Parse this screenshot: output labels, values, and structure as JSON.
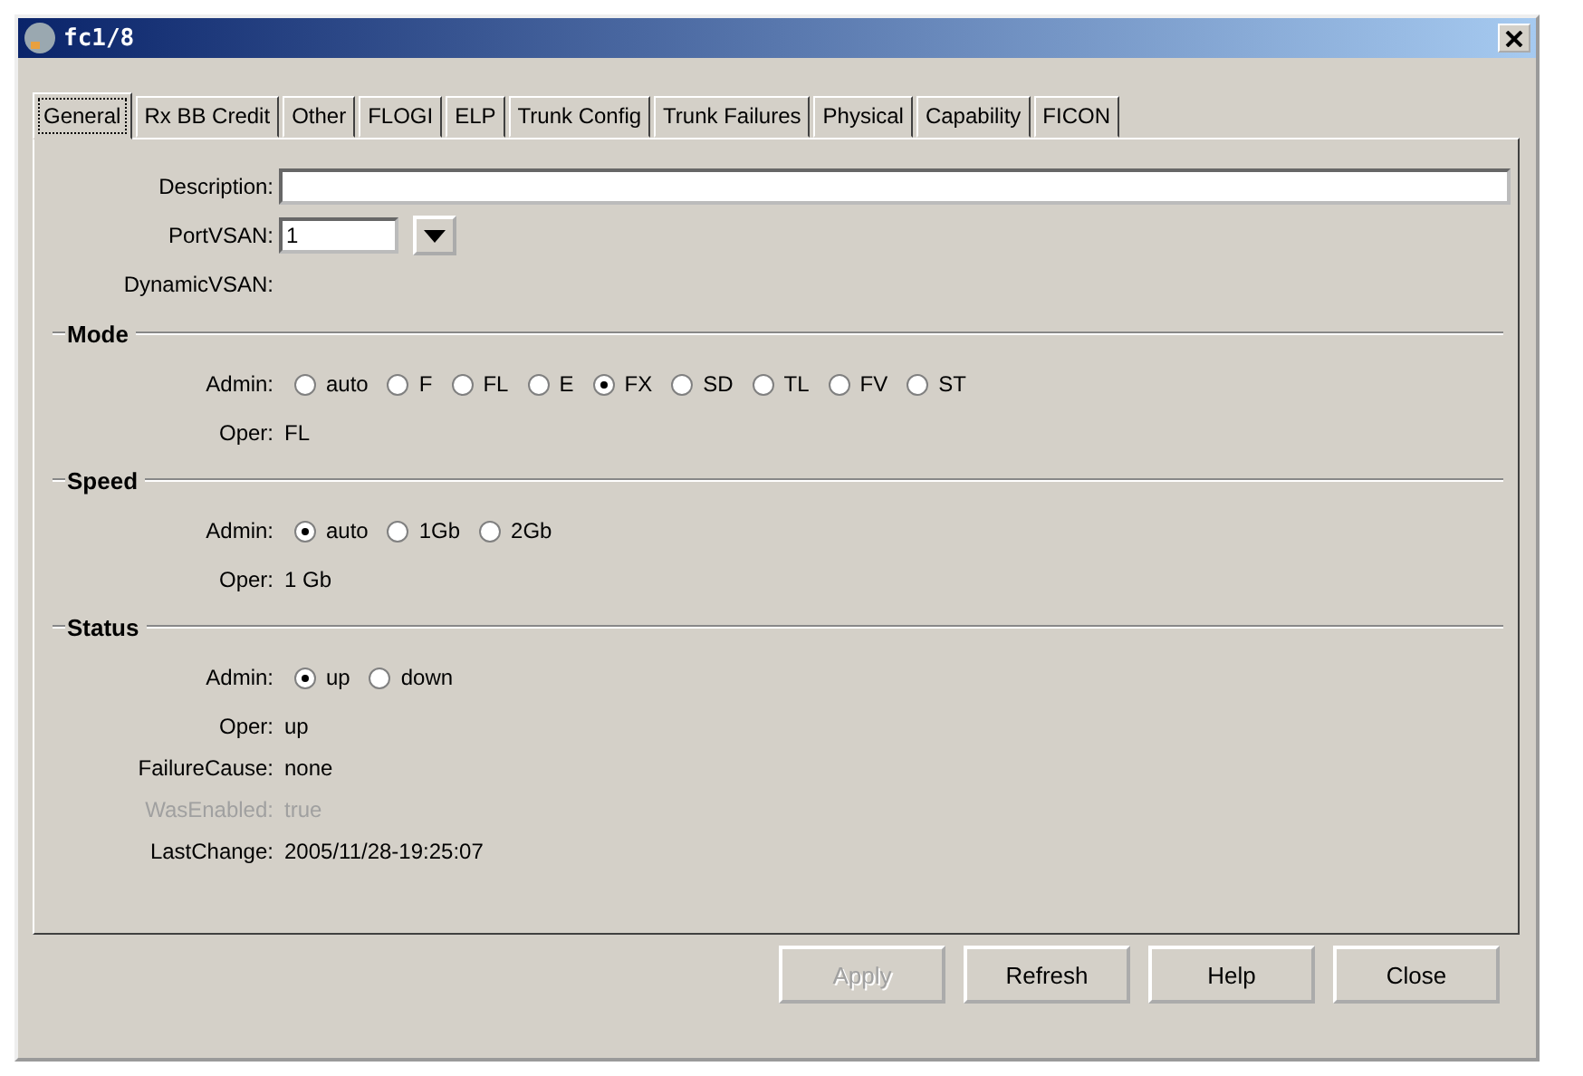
{
  "window": {
    "title": "fc1/8"
  },
  "tabs": [
    {
      "label": "General",
      "selected": true
    },
    {
      "label": "Rx BB Credit",
      "selected": false
    },
    {
      "label": "Other",
      "selected": false
    },
    {
      "label": "FLOGI",
      "selected": false
    },
    {
      "label": "ELP",
      "selected": false
    },
    {
      "label": "Trunk Config",
      "selected": false
    },
    {
      "label": "Trunk Failures",
      "selected": false
    },
    {
      "label": "Physical",
      "selected": false
    },
    {
      "label": "Capability",
      "selected": false
    },
    {
      "label": "FICON",
      "selected": false
    }
  ],
  "description": {
    "label": "Description:"
  },
  "port_vsan": {
    "label": "PortVSAN:",
    "value": "1"
  },
  "dynamic_vsan": {
    "label": "DynamicVSAN:"
  },
  "sections": [
    {
      "title": "Mode",
      "rows": [
        {
          "kind": "radio",
          "label": "Admin:",
          "options": [
            {
              "label": "auto",
              "selected": false
            },
            {
              "label": "F",
              "selected": false
            },
            {
              "label": "FL",
              "selected": false
            },
            {
              "label": "E",
              "selected": false
            },
            {
              "label": "FX",
              "selected": true
            },
            {
              "label": "SD",
              "selected": false
            },
            {
              "label": "TL",
              "selected": false
            },
            {
              "label": "FV",
              "selected": false
            },
            {
              "label": "ST",
              "selected": false
            }
          ]
        },
        {
          "kind": "text",
          "label": "Oper:",
          "value": "FL",
          "disabled": false
        }
      ]
    },
    {
      "title": "Speed",
      "rows": [
        {
          "kind": "radio",
          "label": "Admin:",
          "options": [
            {
              "label": "auto",
              "selected": true
            },
            {
              "label": "1Gb",
              "selected": false
            },
            {
              "label": "2Gb",
              "selected": false
            }
          ]
        },
        {
          "kind": "text",
          "label": "Oper:",
          "value": "1 Gb",
          "disabled": false
        }
      ]
    },
    {
      "title": "Status",
      "rows": [
        {
          "kind": "radio",
          "label": "Admin:",
          "options": [
            {
              "label": "up",
              "selected": true
            },
            {
              "label": "down",
              "selected": false
            }
          ]
        },
        {
          "kind": "text",
          "label": "Oper:",
          "value": "up",
          "disabled": false
        },
        {
          "kind": "text",
          "label": "FailureCause:",
          "value": "none",
          "disabled": false
        },
        {
          "kind": "text",
          "label": "WasEnabled:",
          "value": "true",
          "disabled": true
        },
        {
          "kind": "text",
          "label": "LastChange:",
          "value": "2005/11/28-19:25:07",
          "disabled": false
        }
      ]
    }
  ],
  "buttons": [
    {
      "label": "Apply",
      "disabled": true
    },
    {
      "label": "Refresh",
      "disabled": false
    },
    {
      "label": "Help",
      "disabled": false
    },
    {
      "label": "Close",
      "disabled": false
    }
  ]
}
